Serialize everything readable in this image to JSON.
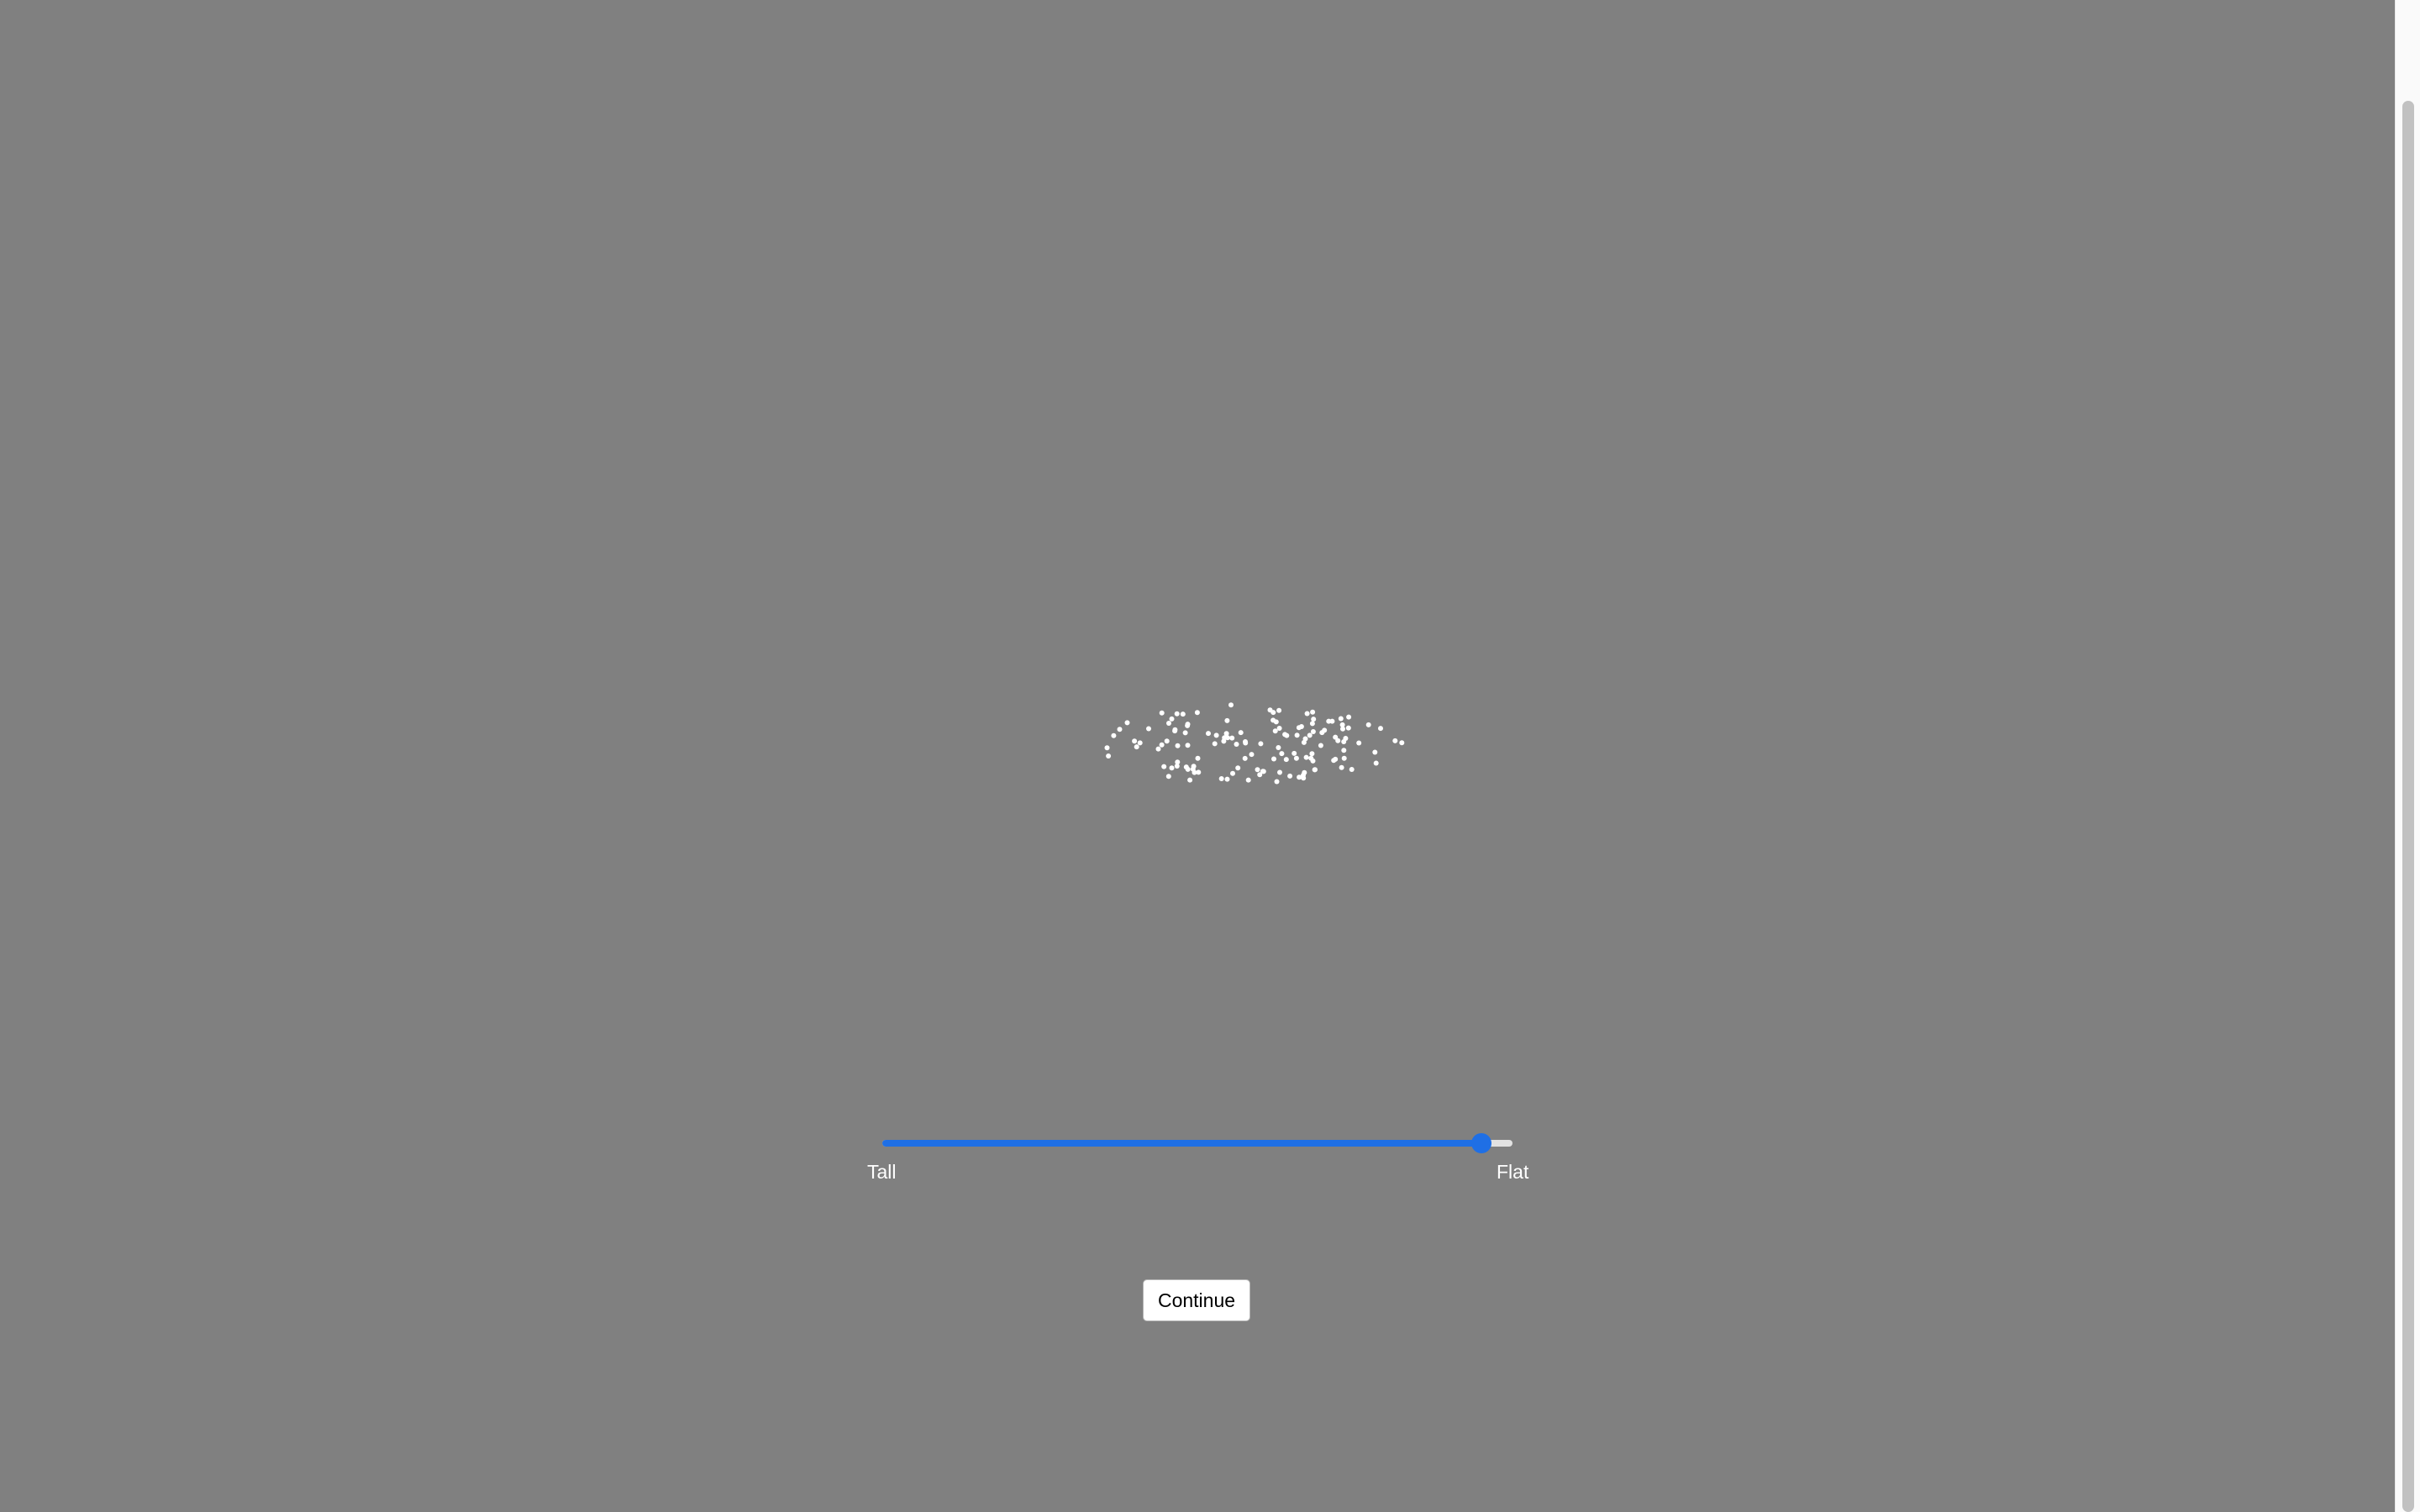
{
  "stimulus": {
    "dot_color": "#ffffff",
    "dot_count": 130
  },
  "slider": {
    "left_label": "Tall",
    "right_label": "Flat",
    "value_fraction": 0.95,
    "fill_color": "#1f6fe5",
    "track_color": "#e2e2e2"
  },
  "continue_label": "Continue",
  "colors": {
    "background": "#808080"
  }
}
